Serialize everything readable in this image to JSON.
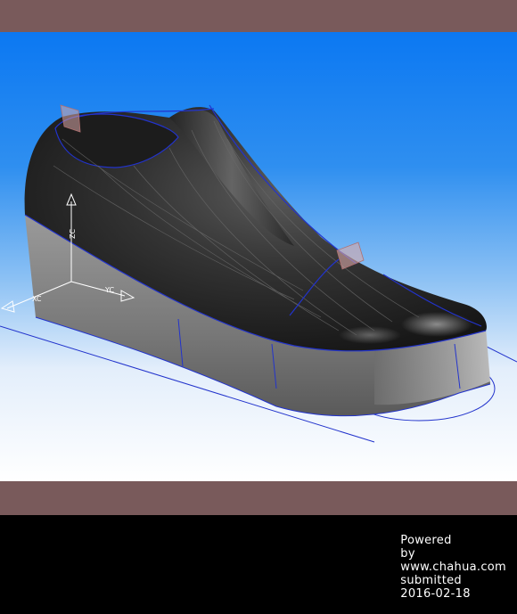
{
  "viewport": {
    "model": "shoe-last",
    "axes": {
      "z_label": "ZC",
      "y_label": "YC",
      "x_label": "XC"
    }
  },
  "footer": {
    "powered": "Powered",
    "by": "by",
    "site": "www.chahua.com",
    "submitted": "submitted",
    "date": "2016-02-18"
  },
  "colors": {
    "frame_bar": "#795a5b",
    "sky_top": "#0b78f2",
    "curve_blue": "#2233cc",
    "sole_gray": "#8a8a8a",
    "upper_black": "#2a2a2a"
  }
}
